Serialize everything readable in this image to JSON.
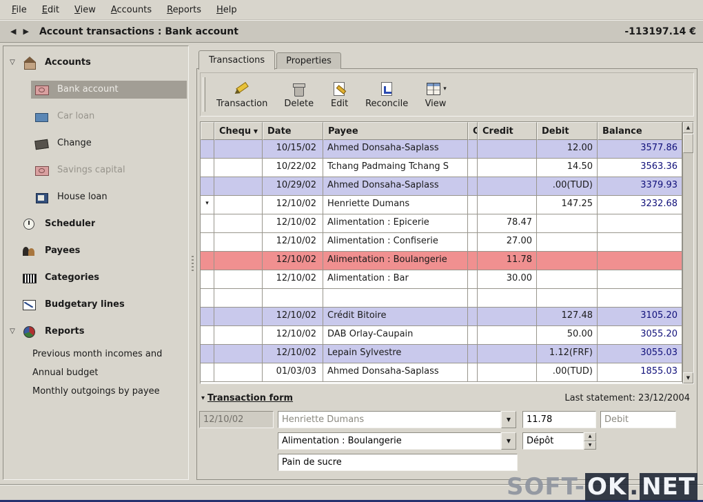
{
  "icons": {
    "dropdown": "▼",
    "up": "▲",
    "down": "▼",
    "back": "◀",
    "forward": "▶"
  },
  "menu": {
    "items": [
      {
        "label": "File"
      },
      {
        "label": "Edit"
      },
      {
        "label": "View"
      },
      {
        "label": "Accounts"
      },
      {
        "label": "Reports"
      },
      {
        "label": "Help"
      }
    ]
  },
  "titlebar": {
    "title": "Account transactions : Bank account",
    "balance": "-113197.14 €"
  },
  "sidebar": {
    "items": [
      {
        "label": "Accounts",
        "level": "l0",
        "expander": "▽",
        "icon": "house"
      },
      {
        "label": "Bank account",
        "level": "l1",
        "icon": "money",
        "variant": "selected"
      },
      {
        "label": "Car loan",
        "level": "l1",
        "icon": "wallet-blue",
        "variant": "muted"
      },
      {
        "label": "Change",
        "level": "l1",
        "icon": "wallet-dark"
      },
      {
        "label": "Savings capital",
        "level": "l1",
        "icon": "money-red",
        "variant": "muted"
      },
      {
        "label": "House loan",
        "level": "l1",
        "icon": "book-blue"
      },
      {
        "label": "Scheduler",
        "level": "l0",
        "icon": "clock"
      },
      {
        "label": "Payees",
        "level": "l0",
        "icon": "people"
      },
      {
        "label": "Categories",
        "level": "l0",
        "icon": "barcode"
      },
      {
        "label": "Budgetary lines",
        "level": "l0",
        "icon": "chart"
      },
      {
        "label": "Reports",
        "level": "l0",
        "expander": "▽",
        "icon": "pie"
      },
      {
        "label": "Previous month incomes and",
        "level": "l2"
      },
      {
        "label": "Annual budget",
        "level": "l2"
      },
      {
        "label": "Monthly outgoings by payee",
        "level": "l2"
      }
    ]
  },
  "tabs": {
    "items": [
      {
        "label": "Transactions",
        "variant": "active"
      },
      {
        "label": "Properties"
      }
    ]
  },
  "toolbar": {
    "buttons": [
      {
        "label": "Transaction",
        "icon": "transaction"
      },
      {
        "label": "Delete",
        "icon": "delete"
      },
      {
        "label": "Edit",
        "icon": "edit"
      },
      {
        "label": "Reconcile",
        "icon": "reconcile"
      },
      {
        "label": "View",
        "icon": "view",
        "dropdown": "▾"
      }
    ]
  },
  "table": {
    "headers": [
      {
        "label": ""
      },
      {
        "label": "Chequ",
        "sort": "▼"
      },
      {
        "label": "Date"
      },
      {
        "label": "Payee"
      },
      {
        "label": "C"
      },
      {
        "label": "Credit"
      },
      {
        "label": "Debit"
      },
      {
        "label": "Balance"
      }
    ],
    "rows": [
      {
        "date": "10/15/02",
        "payee": "Ahmed Donsaha-Saplass",
        "debit": "12.00",
        "balance": "3577.86",
        "variant": "alt"
      },
      {
        "date": "10/22/02",
        "payee": "Tchang Padmaing Tchang S",
        "debit": "14.50",
        "balance": "3563.36"
      },
      {
        "date": "10/29/02",
        "payee": "Ahmed Donsaha-Saplass",
        "debit": ".00(TUD)",
        "balance": "3379.93",
        "variant": "alt"
      },
      {
        "marker": "▾",
        "date": "12/10/02",
        "payee": "Henriette Dumans",
        "debit": "147.25",
        "balance": "3232.68"
      },
      {
        "date": "12/10/02",
        "payee": "Alimentation : Epicerie",
        "credit": "78.47"
      },
      {
        "date": "12/10/02",
        "payee": "Alimentation : Confiserie",
        "credit": "27.00"
      },
      {
        "date": "12/10/02",
        "payee": "Alimentation : Boulangerie",
        "credit": "11.78",
        "variant": "sel"
      },
      {
        "date": "12/10/02",
        "payee": "Alimentation : Bar",
        "credit": "30.00"
      },
      {},
      {
        "date": "12/10/02",
        "payee": "Crédit Bitoire",
        "debit": "127.48",
        "balance": "3105.20",
        "variant": "alt"
      },
      {
        "date": "12/10/02",
        "payee": "DAB Orlay-Caupain",
        "debit": "50.00",
        "balance": "3055.20"
      },
      {
        "date": "12/10/02",
        "payee": "Lepain Sylvestre",
        "debit": "1.12(FRF)",
        "balance": "3055.03",
        "variant": "alt"
      },
      {
        "date": "01/03/03",
        "payee": "Ahmed Donsaha-Saplass",
        "debit": ".00(TUD)",
        "balance": "1855.03"
      }
    ]
  },
  "form": {
    "collapse_icon": "▾",
    "header": "Transaction form",
    "last_statement": "Last statement: 23/12/2004",
    "date_value": "12/10/02",
    "payee_value": "Henriette Dumans",
    "amount_value": "11.78",
    "debit_value": "Debit",
    "category_value": "Alimentation : Boulangerie",
    "method_value": "Dépôt",
    "note_value": "Pain de sucre"
  },
  "watermark": {
    "part1": "SOFT-",
    "part2": "OK",
    "sep": ".",
    "part3": "NET"
  }
}
